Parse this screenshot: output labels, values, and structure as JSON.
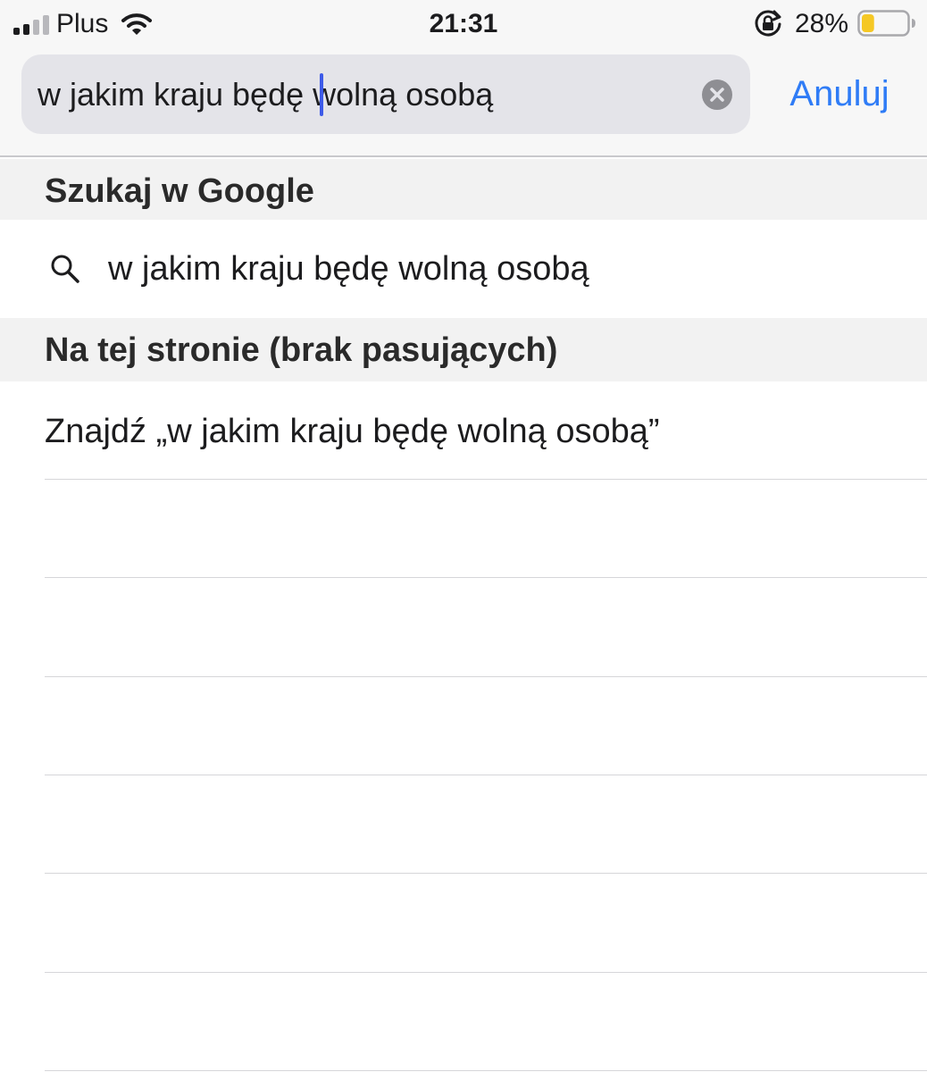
{
  "status_bar": {
    "carrier": "Plus",
    "time": "21:31",
    "battery_percent": "28%",
    "battery_level": 0.28,
    "signal_bars": 2,
    "icons": [
      "signal-icon",
      "wifi-icon",
      "orientation-lock-icon",
      "battery-icon"
    ]
  },
  "search": {
    "query": "w jakim kraju będę wolną osobą",
    "cancel_label": "Anuluj",
    "icons": [
      "clear-icon"
    ]
  },
  "google_section": {
    "header": "Szukaj w Google",
    "suggestion": "w jakim kraju będę wolną osobą",
    "icons": [
      "search-icon"
    ]
  },
  "page_section": {
    "header": "Na tej stronie (brak pasujących)",
    "find_text": "Znajdź „w jakim kraju będę wolną osobą”"
  },
  "colors": {
    "accent": "#2f7cf6",
    "caret": "#3d5ae8",
    "battery_fill": "#f5c825",
    "search_field_bg": "#e4e4e9",
    "section_header_bg": "#f2f2f2"
  }
}
